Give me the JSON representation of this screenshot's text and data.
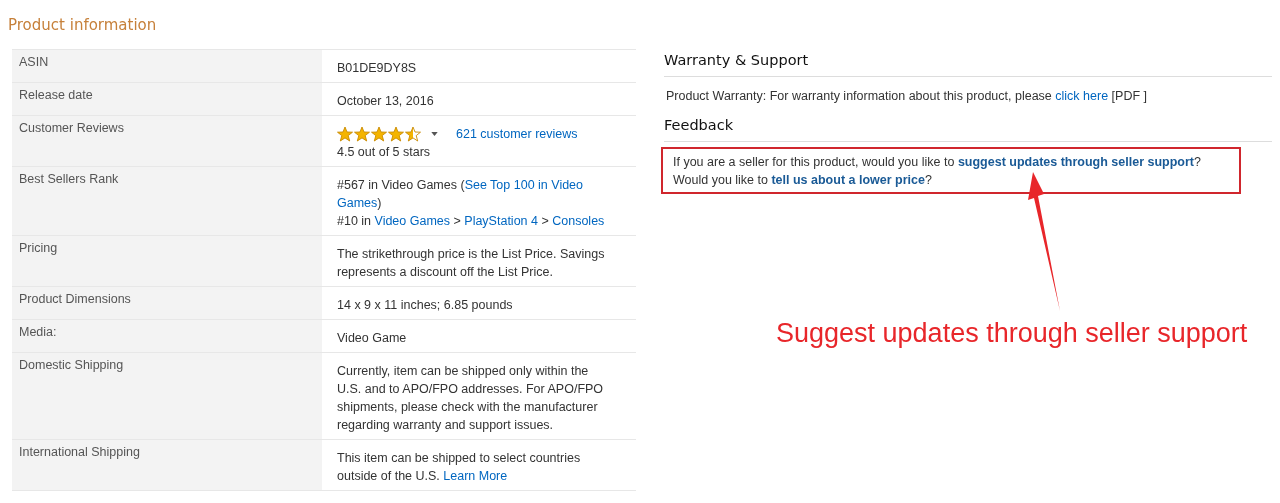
{
  "product_information": {
    "title": "Product information",
    "rows": [
      {
        "label": "ASIN",
        "kind": "text",
        "lines": [
          [
            {
              "kind": "plain",
              "text": "B01DE9DY8S"
            }
          ]
        ]
      },
      {
        "label": "Release date",
        "kind": "text",
        "lines": [
          [
            {
              "kind": "plain",
              "text": "October 13, 2016"
            }
          ]
        ]
      },
      {
        "label": "Customer Reviews",
        "kind": "reviews",
        "stars": 4.5,
        "reviews_link": "621 customer reviews",
        "rating_text": "4.5 out of 5 stars"
      },
      {
        "label": "Best Sellers Rank",
        "kind": "text",
        "lines": [
          [
            {
              "kind": "plain",
              "text": "#567 in Video Games ("
            },
            {
              "kind": "link",
              "text": "See Top 100 in Video"
            }
          ],
          [
            {
              "kind": "link",
              "text": "Games"
            },
            {
              "kind": "plain",
              "text": ")"
            }
          ],
          [
            {
              "kind": "plain",
              "text": "#10 in "
            },
            {
              "kind": "link",
              "text": "Video Games"
            },
            {
              "kind": "plain",
              "text": " > "
            },
            {
              "kind": "link",
              "text": "PlayStation 4"
            },
            {
              "kind": "plain",
              "text": " > "
            },
            {
              "kind": "link",
              "text": "Consoles"
            }
          ]
        ]
      },
      {
        "label": "Pricing",
        "kind": "text",
        "lines": [
          [
            {
              "kind": "plain",
              "text": "The strikethrough price is the List Price. Savings represents a discount off the List Price."
            }
          ]
        ]
      },
      {
        "label": "Product Dimensions",
        "kind": "text",
        "lines": [
          [
            {
              "kind": "plain",
              "text": "14 x 9 x 11 inches; 6.85 pounds"
            }
          ]
        ]
      },
      {
        "label": "Media:",
        "kind": "text",
        "lines": [
          [
            {
              "kind": "plain",
              "text": "Video Game"
            }
          ]
        ]
      },
      {
        "label": "Domestic Shipping",
        "kind": "text",
        "lines": [
          [
            {
              "kind": "plain",
              "text": "Currently, item can be shipped only within the U.S. and to APO/FPO addresses. For APO/FPO shipments, please check with the manufacturer regarding warranty and support issues."
            }
          ]
        ]
      },
      {
        "label": "International Shipping",
        "kind": "text",
        "lines": [
          [
            {
              "kind": "plain",
              "text": "This item can be shipped to select countries outside of the U.S. "
            },
            {
              "kind": "link",
              "text": "Learn More"
            }
          ]
        ]
      }
    ]
  },
  "warranty": {
    "title": "Warranty & Support",
    "lines": [
      [
        {
          "kind": "plain",
          "text": "Product Warranty: For warranty information about this product, please "
        },
        {
          "kind": "link",
          "text": "click here"
        },
        {
          "kind": "plain",
          "text": " [PDF ]"
        }
      ]
    ]
  },
  "feedback": {
    "title": "Feedback",
    "highlighted": true,
    "lines": [
      [
        {
          "kind": "plain",
          "text": "If you are a seller for this product, would you like to "
        },
        {
          "kind": "link",
          "text": "suggest updates through seller support"
        },
        {
          "kind": "plain",
          "text": "?"
        }
      ],
      [
        {
          "kind": "plain",
          "text": "Would you like to "
        },
        {
          "kind": "link",
          "text": "tell us about a lower price"
        },
        {
          "kind": "plain",
          "text": "?"
        }
      ]
    ]
  },
  "annotation": {
    "text": "Suggest updates through seller support"
  }
}
